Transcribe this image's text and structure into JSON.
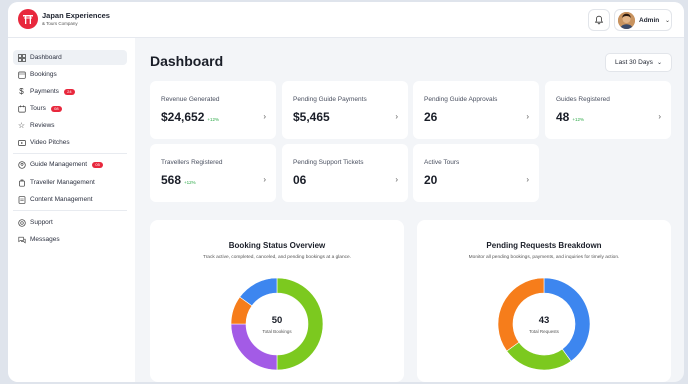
{
  "brand": {
    "name": "Japan Experiences",
    "sub": "& Tours Company"
  },
  "header": {
    "user_name": "Admin"
  },
  "sidebar": {
    "items": [
      {
        "label": "Dashboard",
        "icon": "dashboard-icon"
      },
      {
        "label": "Bookings",
        "icon": "bookings-icon"
      },
      {
        "label": "Payments",
        "icon": "payments-icon",
        "badge": "24"
      },
      {
        "label": "Tours",
        "icon": "tours-icon",
        "badge": "08"
      },
      {
        "label": "Reviews",
        "icon": "star-icon"
      },
      {
        "label": "Video Pitches",
        "icon": "video-icon"
      },
      {
        "label": "Guide Management",
        "icon": "guide-icon",
        "badge": "05"
      },
      {
        "label": "Traveller Management",
        "icon": "traveller-icon"
      },
      {
        "label": "Content Management",
        "icon": "content-icon"
      },
      {
        "label": "Support",
        "icon": "support-icon"
      },
      {
        "label": "Messages",
        "icon": "messages-icon"
      }
    ]
  },
  "main": {
    "title": "Dashboard",
    "range_label": "Last 30 Days",
    "cards": [
      {
        "label": "Revenue Generated",
        "value": "$24,652",
        "change": "+12%"
      },
      {
        "label": "Pending Guide Payments",
        "value": "$5,465"
      },
      {
        "label": "Pending Guide Approvals",
        "value": "26"
      },
      {
        "label": "Guides Registered",
        "value": "48",
        "change": "+12%"
      },
      {
        "label": "Travellers Registered",
        "value": "568",
        "change": "+12%"
      },
      {
        "label": "Pending Support Tickets",
        "value": "06"
      },
      {
        "label": "Active Tours",
        "value": "20"
      }
    ],
    "panels": [
      {
        "title": "Booking Status Overview",
        "subtitle": "Track active, completed, canceled, and pending bookings at a glance.",
        "center_value": "50",
        "center_label": "Total Bookings"
      },
      {
        "title": "Pending Requests Breakdown",
        "subtitle": "Monitor all pending bookings, payments, and inquiries for timely action.",
        "center_value": "43",
        "center_label": "Total Requests"
      }
    ]
  },
  "colors": {
    "accent": "#e8283d",
    "green": "#7cc91f",
    "blue": "#3d86ef",
    "orange": "#f67d1b",
    "purple": "#a35be6",
    "positive": "#2aa845"
  },
  "chart_data": [
    {
      "type": "pie",
      "center_value": "50",
      "center_label": "Total Bookings",
      "slices": [
        {
          "color": "#7cc91f",
          "value": 0.5
        },
        {
          "color": "#a35be6",
          "value": 0.25
        },
        {
          "color": "#f67d1b",
          "value": 0.1
        },
        {
          "color": "#3d86ef",
          "value": 0.15
        }
      ]
    },
    {
      "type": "pie",
      "center_value": "43",
      "center_label": "Total Requests",
      "slices": [
        {
          "color": "#3d86ef",
          "value": 0.4
        },
        {
          "color": "#7cc91f",
          "value": 0.25
        },
        {
          "color": "#f67d1b",
          "value": 0.35
        }
      ]
    }
  ]
}
